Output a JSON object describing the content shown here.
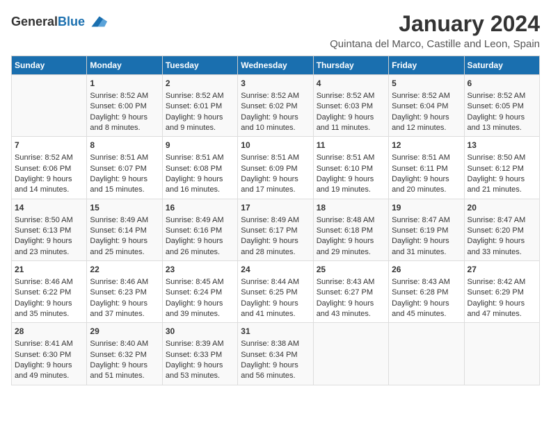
{
  "logo": {
    "general": "General",
    "blue": "Blue"
  },
  "title": "January 2024",
  "subtitle": "Quintana del Marco, Castille and Leon, Spain",
  "weekdays": [
    "Sunday",
    "Monday",
    "Tuesday",
    "Wednesday",
    "Thursday",
    "Friday",
    "Saturday"
  ],
  "weeks": [
    [
      {
        "day": "",
        "sunrise": "",
        "sunset": "",
        "daylight": ""
      },
      {
        "day": "1",
        "sunrise": "Sunrise: 8:52 AM",
        "sunset": "Sunset: 6:00 PM",
        "daylight": "Daylight: 9 hours and 8 minutes."
      },
      {
        "day": "2",
        "sunrise": "Sunrise: 8:52 AM",
        "sunset": "Sunset: 6:01 PM",
        "daylight": "Daylight: 9 hours and 9 minutes."
      },
      {
        "day": "3",
        "sunrise": "Sunrise: 8:52 AM",
        "sunset": "Sunset: 6:02 PM",
        "daylight": "Daylight: 9 hours and 10 minutes."
      },
      {
        "day": "4",
        "sunrise": "Sunrise: 8:52 AM",
        "sunset": "Sunset: 6:03 PM",
        "daylight": "Daylight: 9 hours and 11 minutes."
      },
      {
        "day": "5",
        "sunrise": "Sunrise: 8:52 AM",
        "sunset": "Sunset: 6:04 PM",
        "daylight": "Daylight: 9 hours and 12 minutes."
      },
      {
        "day": "6",
        "sunrise": "Sunrise: 8:52 AM",
        "sunset": "Sunset: 6:05 PM",
        "daylight": "Daylight: 9 hours and 13 minutes."
      }
    ],
    [
      {
        "day": "7",
        "sunrise": "Sunrise: 8:52 AM",
        "sunset": "Sunset: 6:06 PM",
        "daylight": "Daylight: 9 hours and 14 minutes."
      },
      {
        "day": "8",
        "sunrise": "Sunrise: 8:51 AM",
        "sunset": "Sunset: 6:07 PM",
        "daylight": "Daylight: 9 hours and 15 minutes."
      },
      {
        "day": "9",
        "sunrise": "Sunrise: 8:51 AM",
        "sunset": "Sunset: 6:08 PM",
        "daylight": "Daylight: 9 hours and 16 minutes."
      },
      {
        "day": "10",
        "sunrise": "Sunrise: 8:51 AM",
        "sunset": "Sunset: 6:09 PM",
        "daylight": "Daylight: 9 hours and 17 minutes."
      },
      {
        "day": "11",
        "sunrise": "Sunrise: 8:51 AM",
        "sunset": "Sunset: 6:10 PM",
        "daylight": "Daylight: 9 hours and 19 minutes."
      },
      {
        "day": "12",
        "sunrise": "Sunrise: 8:51 AM",
        "sunset": "Sunset: 6:11 PM",
        "daylight": "Daylight: 9 hours and 20 minutes."
      },
      {
        "day": "13",
        "sunrise": "Sunrise: 8:50 AM",
        "sunset": "Sunset: 6:12 PM",
        "daylight": "Daylight: 9 hours and 21 minutes."
      }
    ],
    [
      {
        "day": "14",
        "sunrise": "Sunrise: 8:50 AM",
        "sunset": "Sunset: 6:13 PM",
        "daylight": "Daylight: 9 hours and 23 minutes."
      },
      {
        "day": "15",
        "sunrise": "Sunrise: 8:49 AM",
        "sunset": "Sunset: 6:14 PM",
        "daylight": "Daylight: 9 hours and 25 minutes."
      },
      {
        "day": "16",
        "sunrise": "Sunrise: 8:49 AM",
        "sunset": "Sunset: 6:16 PM",
        "daylight": "Daylight: 9 hours and 26 minutes."
      },
      {
        "day": "17",
        "sunrise": "Sunrise: 8:49 AM",
        "sunset": "Sunset: 6:17 PM",
        "daylight": "Daylight: 9 hours and 28 minutes."
      },
      {
        "day": "18",
        "sunrise": "Sunrise: 8:48 AM",
        "sunset": "Sunset: 6:18 PM",
        "daylight": "Daylight: 9 hours and 29 minutes."
      },
      {
        "day": "19",
        "sunrise": "Sunrise: 8:47 AM",
        "sunset": "Sunset: 6:19 PM",
        "daylight": "Daylight: 9 hours and 31 minutes."
      },
      {
        "day": "20",
        "sunrise": "Sunrise: 8:47 AM",
        "sunset": "Sunset: 6:20 PM",
        "daylight": "Daylight: 9 hours and 33 minutes."
      }
    ],
    [
      {
        "day": "21",
        "sunrise": "Sunrise: 8:46 AM",
        "sunset": "Sunset: 6:22 PM",
        "daylight": "Daylight: 9 hours and 35 minutes."
      },
      {
        "day": "22",
        "sunrise": "Sunrise: 8:46 AM",
        "sunset": "Sunset: 6:23 PM",
        "daylight": "Daylight: 9 hours and 37 minutes."
      },
      {
        "day": "23",
        "sunrise": "Sunrise: 8:45 AM",
        "sunset": "Sunset: 6:24 PM",
        "daylight": "Daylight: 9 hours and 39 minutes."
      },
      {
        "day": "24",
        "sunrise": "Sunrise: 8:44 AM",
        "sunset": "Sunset: 6:25 PM",
        "daylight": "Daylight: 9 hours and 41 minutes."
      },
      {
        "day": "25",
        "sunrise": "Sunrise: 8:43 AM",
        "sunset": "Sunset: 6:27 PM",
        "daylight": "Daylight: 9 hours and 43 minutes."
      },
      {
        "day": "26",
        "sunrise": "Sunrise: 8:43 AM",
        "sunset": "Sunset: 6:28 PM",
        "daylight": "Daylight: 9 hours and 45 minutes."
      },
      {
        "day": "27",
        "sunrise": "Sunrise: 8:42 AM",
        "sunset": "Sunset: 6:29 PM",
        "daylight": "Daylight: 9 hours and 47 minutes."
      }
    ],
    [
      {
        "day": "28",
        "sunrise": "Sunrise: 8:41 AM",
        "sunset": "Sunset: 6:30 PM",
        "daylight": "Daylight: 9 hours and 49 minutes."
      },
      {
        "day": "29",
        "sunrise": "Sunrise: 8:40 AM",
        "sunset": "Sunset: 6:32 PM",
        "daylight": "Daylight: 9 hours and 51 minutes."
      },
      {
        "day": "30",
        "sunrise": "Sunrise: 8:39 AM",
        "sunset": "Sunset: 6:33 PM",
        "daylight": "Daylight: 9 hours and 53 minutes."
      },
      {
        "day": "31",
        "sunrise": "Sunrise: 8:38 AM",
        "sunset": "Sunset: 6:34 PM",
        "daylight": "Daylight: 9 hours and 56 minutes."
      },
      {
        "day": "",
        "sunrise": "",
        "sunset": "",
        "daylight": ""
      },
      {
        "day": "",
        "sunrise": "",
        "sunset": "",
        "daylight": ""
      },
      {
        "day": "",
        "sunrise": "",
        "sunset": "",
        "daylight": ""
      }
    ]
  ]
}
